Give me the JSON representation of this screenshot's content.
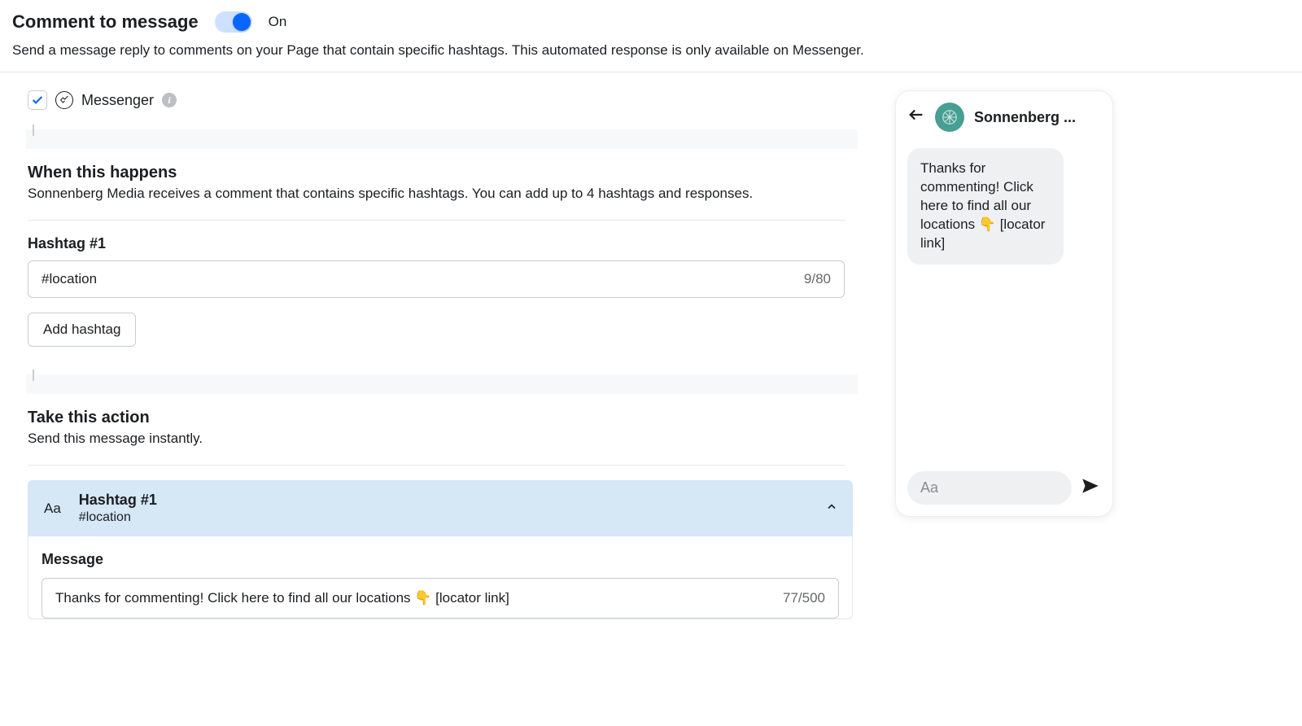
{
  "header": {
    "title": "Comment to message",
    "toggle_state": "On",
    "description": "Send a message reply to comments on your Page that contain specific hashtags. This automated response is only available on Messenger."
  },
  "platform": {
    "checked": true,
    "name": "Messenger"
  },
  "when_section": {
    "title": "When this happens",
    "description": "Sonnenberg Media receives a comment that contains specific hashtags. You can add up to 4 hashtags and responses.",
    "hashtag_label": "Hashtag #1",
    "hashtag_value": "#location",
    "hashtag_count": "9/80",
    "add_button": "Add hashtag"
  },
  "action_section": {
    "title": "Take this action",
    "description": "Send this message instantly.",
    "card_icon": "Aa",
    "card_title": "Hashtag #1",
    "card_sub": "#location",
    "message_label": "Message",
    "message_value": "Thanks for commenting! Click here to find all our locations 👇 [locator link]",
    "message_count": "77/500"
  },
  "preview": {
    "title": "Sonnenberg ...",
    "bubble": "Thanks for commenting! Click here to find all our locations 👇 [locator link]",
    "compose_placeholder": "Aa"
  }
}
